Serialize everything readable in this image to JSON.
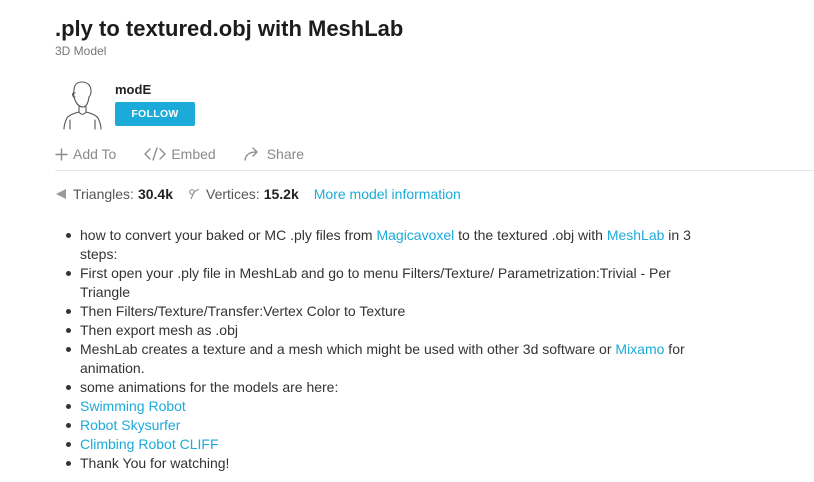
{
  "model": {
    "title": ".ply to textured.obj with MeshLab",
    "type_label": "3D Model"
  },
  "author": {
    "name": "modE",
    "follow_label": "FOLLOW"
  },
  "actions": {
    "add_to": "Add To",
    "embed": "Embed",
    "share": "Share"
  },
  "stats": {
    "triangles_label": "Triangles:",
    "triangles_value": "30.4k",
    "vertices_label": "Vertices:",
    "vertices_value": "15.2k",
    "more_info_link": "More model information"
  },
  "description": {
    "item1": {
      "a": "how to convert your baked or MC .ply files from ",
      "link1": "Magicavoxel",
      "b": " to the textured .obj with ",
      "link2": "MeshLab",
      "c": " in 3 steps:"
    },
    "item2": "First open your .ply file in MeshLab and go to menu Filters/Texture/ Parametrization:Trivial - Per Triangle",
    "item3": "Then Filters/Texture/Transfer:Vertex Color to Texture",
    "item4": "Then export mesh as .obj",
    "item5": {
      "a": "MeshLab creates a texture and a mesh which might be used with other 3d software or ",
      "link": "Mixamo",
      "b": " for animation."
    },
    "item6": "some animations for the models are here:",
    "item7_link": "Swimming Robot",
    "item8_link": "Robot Skysurfer",
    "item9_link": "Climbing Robot CLIFF",
    "item10": "Thank You for watching!"
  },
  "colors": {
    "accent": "#1caad9",
    "title": "#1c1c1c",
    "text": "#333333",
    "muted": "#8a8a8a"
  },
  "icons": {
    "add_to": "plus-icon",
    "embed": "code-icon",
    "share": "share-arrow-icon",
    "triangles": "triangle-icon",
    "vertices": "vertex-icon",
    "avatar": "user-outline-avatar"
  }
}
